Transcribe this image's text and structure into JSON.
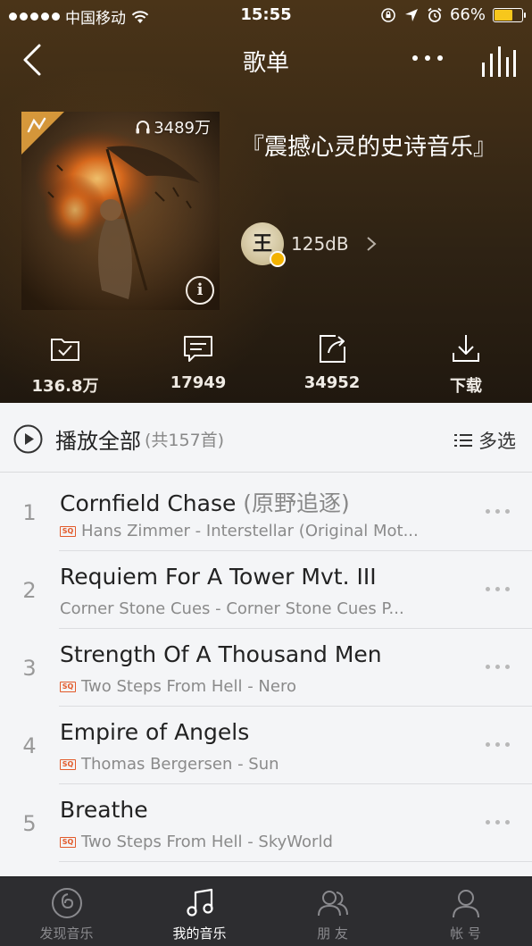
{
  "status_bar": {
    "carrier": "中国移动",
    "time": "15:55",
    "battery": "66%"
  },
  "nav": {
    "title": "歌单"
  },
  "playlist": {
    "plays": "3489万",
    "title": "『震撼心灵的史诗音乐』",
    "creator_name": "125dB",
    "creator_avatar_text": "王"
  },
  "actions": [
    {
      "icon": "favorite-folder-icon",
      "label": "136.8万"
    },
    {
      "icon": "comment-icon",
      "label": "17949"
    },
    {
      "icon": "share-icon",
      "label": "34952"
    },
    {
      "icon": "download-icon",
      "label": "下载"
    }
  ],
  "play_all": {
    "label": "播放全部",
    "count": "(共157首)",
    "multi_select": "多选"
  },
  "songs": [
    {
      "index": "1",
      "title": "Cornfield Chase",
      "alias": " (原野追逐)",
      "sq": true,
      "subtitle": "Hans Zimmer - Interstellar (Original Mot..."
    },
    {
      "index": "2",
      "title": "Requiem For A Tower Mvt. III",
      "alias": "",
      "sq": false,
      "subtitle": "Corner Stone Cues - Corner Stone Cues P..."
    },
    {
      "index": "3",
      "title": "Strength Of A Thousand Men",
      "alias": "",
      "sq": true,
      "subtitle": "Two Steps From Hell - Nero"
    },
    {
      "index": "4",
      "title": "Empire of Angels",
      "alias": "",
      "sq": true,
      "subtitle": "Thomas Bergersen - Sun"
    },
    {
      "index": "5",
      "title": "Breathe",
      "alias": "",
      "sq": true,
      "subtitle": "Two Steps From Hell - SkyWorld"
    }
  ],
  "sq_badge": "SQ",
  "tabs": [
    {
      "icon": "discover-music-icon",
      "label": "发现音乐",
      "active": false
    },
    {
      "icon": "my-music-icon",
      "label": "我的音乐",
      "active": true
    },
    {
      "icon": "friends-icon",
      "label": "朋 友",
      "active": false
    },
    {
      "icon": "account-icon",
      "label": "帐 号",
      "active": false
    }
  ],
  "colors": {
    "header_bg": "#3e2c16",
    "tabbar_bg": "#2d2d30",
    "battery_fill": "#f7c71c",
    "sq_badge": "#e25a2a"
  }
}
